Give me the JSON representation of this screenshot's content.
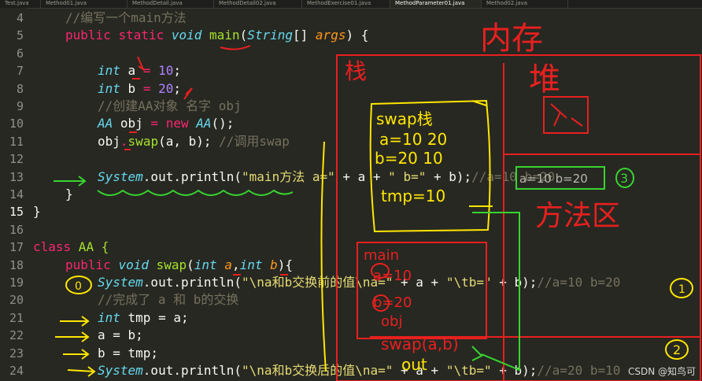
{
  "tabs": [
    "Test.java",
    "Method01.java",
    "MethodDetail.java",
    "MethodDetail02.java",
    "MethodExercise01.java",
    "MethodParameter01.java",
    "Method02.java"
  ],
  "active_tab": "MethodParameter01.java",
  "line_numbers": [
    "4",
    "5",
    "6",
    "7",
    "8",
    "9",
    "10",
    "11",
    "12",
    "13",
    "14",
    "15",
    "16",
    "17",
    "18",
    "19",
    "20",
    "21",
    "22",
    "23",
    "24"
  ],
  "active_line": "15",
  "code": {
    "l4_comment": "//编写一个main方法",
    "l5": {
      "kw1": "public",
      "kw2": "static",
      "type": "void",
      "fn": "main",
      "p1": "(",
      "cls": "String",
      "p2": "[] ",
      "arg": "args",
      "p3": ") {"
    },
    "l7": {
      "type": "int",
      "var": "a",
      "eq": " = ",
      "num": "10",
      "end": ";"
    },
    "l8": {
      "type": "int",
      "var": "b",
      "eq": " = ",
      "num": "20",
      "end": ";"
    },
    "l9_comment": "//创建AA对象 名字 obj",
    "l10": {
      "type": "AA",
      "var": " obj",
      "eq": " = ",
      "kw": "new",
      "type2": "AA",
      "end": "();"
    },
    "l11": {
      "obj": "obj",
      "dot": ".",
      "fn": "swap",
      "args": "(a, b); ",
      "comment": "//调用swap"
    },
    "l13": {
      "cls": "System",
      "rest": ".out.println(",
      "str": "\"main方法 a=\"",
      "op": " + a + ",
      "str2": "\" b=\"",
      "end": " + b);",
      "comment": "//a=10 b=20"
    },
    "l14": "}",
    "l15": "}",
    "l17": {
      "kw": "class",
      "name": " AA {"
    },
    "l18": {
      "kw": "public",
      "type": "void",
      "fn": "swap",
      "p1": "(",
      "t1": "int",
      "a1": "a",
      ",": ",",
      "t2": "int",
      "a2": "b",
      "end": "){"
    },
    "l19": {
      "cls": "System",
      "rest": ".out.println(",
      "str": "\"\\na和b交换前的值\\na=\"",
      "op": " + a + ",
      "str2": "\"\\tb=\"",
      "end": " + b);",
      "comment": "//a=10 b=20"
    },
    "l20_comment": "//完成了 a 和 b的交换",
    "l21": {
      "type": "int",
      "rest": " tmp = a;"
    },
    "l22": "a = b;",
    "l23": "b = tmp;",
    "l24": {
      "cls": "System",
      "rest": ".out.println(",
      "str": "\"\\na和b交换后的值\\na=\"",
      "op": " + a + ",
      "str2": "\"\\tb=\"",
      "end": " + b);",
      "comment": "//a=20 b=10"
    }
  },
  "annotations": {
    "memory_title": "内存",
    "stack_label": "栈",
    "heap_label": "堆",
    "method_area_label": "方法区",
    "swap_frame": [
      "swap栈",
      "a=10 20",
      "b=20 10",
      "tmp=10"
    ],
    "main_frame": [
      "main",
      "a=10",
      "b=20",
      "obj"
    ],
    "swap_call": "swap(a,b)",
    "out_label": "out",
    "output_3": "a=10 b=20",
    "circle_3": "3",
    "circle_1": "1",
    "circle_2": "2",
    "circle_0": "0"
  },
  "watermark": "CSDN @知鸟可"
}
